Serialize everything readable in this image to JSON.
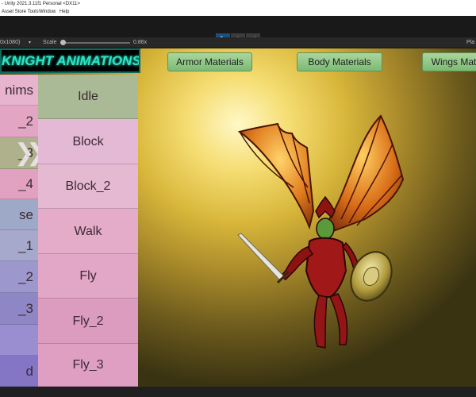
{
  "window": {
    "title": "- Unity 2021.3.11f1 Personal <DX11>"
  },
  "menu": [
    "Asset Store Tools",
    "Window",
    "Help"
  ],
  "playbar": {
    "play_icon": "play-icon",
    "pause_icon": "pause-icon",
    "step_icon": "step-icon",
    "play": "▶",
    "pause": "⏸",
    "step": "⏭"
  },
  "game_toolbar": {
    "resolution": "0x1080)",
    "scale_label": "Scale",
    "scale_value": "0.86x",
    "right_label": "Pla"
  },
  "colors": {
    "accent_play": "#1e4f7a",
    "banner_text": "#35e0c4",
    "material_button": "#8cc584"
  },
  "game": {
    "banner": "KNIGHT ANIMATIONS",
    "material_buttons": [
      "Armor Materials",
      "Body Materials",
      "Wings Mat"
    ],
    "left_column": [
      {
        "label": "nims",
        "color": "#e7b3cf"
      },
      {
        "label": "_2",
        "color": "#e2a6c4"
      },
      {
        "label": "_3",
        "color": "#aeb18c",
        "selected": true
      },
      {
        "label": "_4",
        "color": "#e0a2c0"
      },
      {
        "label": "se",
        "color": "#9ea9c8"
      },
      {
        "label": "_1",
        "color": "#a6a8cc"
      },
      {
        "label": "_2",
        "color": "#9c97cc"
      },
      {
        "label": "_3",
        "color": "#8f86c6"
      },
      {
        "label": "",
        "color": "#9b8ed0"
      },
      {
        "label": "d",
        "color": "#8575c5"
      }
    ],
    "animations": [
      {
        "label": "Idle",
        "color": "#aab996",
        "selected": true
      },
      {
        "label": "Block",
        "color": "#e4b9d5"
      },
      {
        "label": "Block_2",
        "color": "#e6b9d2"
      },
      {
        "label": "Walk",
        "color": "#e4acc9"
      },
      {
        "label": "Fly",
        "color": "#e2a6c6"
      },
      {
        "label": "Fly_2",
        "color": "#dc9cbf"
      },
      {
        "label": "Fly_3",
        "color": "#df9fc3"
      }
    ]
  }
}
